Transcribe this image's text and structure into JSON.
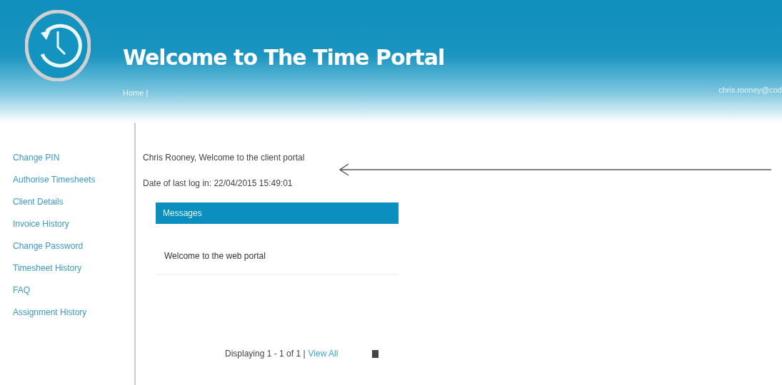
{
  "header": {
    "title": "Welcome to The Time Portal",
    "nav": [
      "Home |"
    ],
    "user": "chris.rooney@cod"
  },
  "sidebar": {
    "items": [
      "Change PIN",
      "Authorise Timesheets",
      "Client Details",
      "Invoice History",
      "Change Password",
      "Timesheet History",
      "FAQ",
      "Assignment History"
    ]
  },
  "main": {
    "greeting": "Chris Rooney, Welcome to the client portal",
    "last_login": "Date of last log in: 22/04/2015 15:49:01",
    "messages": {
      "title": "Messages",
      "items": [
        "Welcome to the web portal"
      ]
    },
    "pager": {
      "text": "Displaying 1 - 1 of 1 |",
      "link": "View All"
    }
  }
}
